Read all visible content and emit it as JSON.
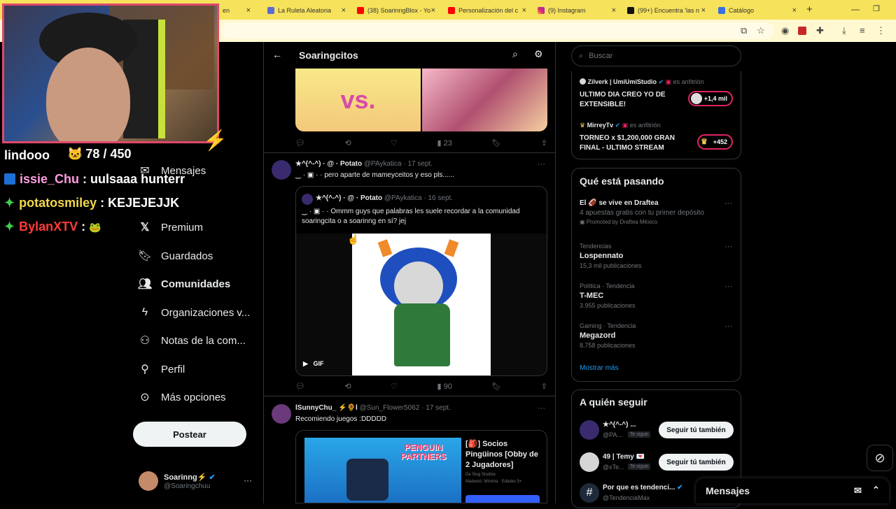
{
  "browser": {
    "tabs": [
      {
        "label": "en",
        "left": 0
      },
      {
        "label": "La Ruleta Aleatoria"
      },
      {
        "label": "(38) SoarinngBlox - Yo"
      },
      {
        "label": "Personalización del c"
      },
      {
        "label": "(9) Instagram"
      },
      {
        "label": "(99+) Encuentra 'las n"
      },
      {
        "label": "Catálogo"
      }
    ],
    "new_tab": "+",
    "close": "×"
  },
  "chat": {
    "counter_label": "lindooo",
    "viewer_count": "78 / 450",
    "lines": [
      {
        "user": "issie_Chu",
        "sep": " : ",
        "msg": "uulsaaa hunterr",
        "color": "#ff9de0"
      },
      {
        "user": "potatosmiley",
        "sep": " : ",
        "msg": "KEJEJEJJK",
        "color": "#f2d84b"
      },
      {
        "user": "BylanXTV",
        "sep": " : ",
        "msg": "",
        "color": "#ff3b3b"
      }
    ]
  },
  "nav": {
    "items": [
      {
        "label": "Mensajes",
        "icon": "mail-icon"
      },
      {
        "label": "Premium",
        "icon": "x-logo-icon"
      },
      {
        "label": "Guardados",
        "icon": "bookmark-icon"
      },
      {
        "label": "Comunidades",
        "icon": "community-icon"
      },
      {
        "label": "Organizaciones v...",
        "icon": "lightning-icon"
      },
      {
        "label": "Notas de la com...",
        "icon": "notes-icon"
      },
      {
        "label": "Perfil",
        "icon": "person-icon"
      },
      {
        "label": "Más opciones",
        "icon": "more-icon"
      }
    ],
    "post_button": "Postear",
    "account": {
      "name": "Soarinng⚡",
      "handle": "@Soaringchuu",
      "more": "···"
    }
  },
  "community": {
    "title": "Soaringcitos",
    "back": "←"
  },
  "tweets": [
    {
      "stats": {
        "views": "23"
      }
    },
    {
      "author": "★^(^-^)  · @ · Potato",
      "handle": "@PAykatica",
      "date": "· 17 sept.",
      "text": "‿ · ▣ ·  ·  pero aparte de mameyceitos y eso pls......",
      "quote": {
        "author": "★^(^-^)  · @ · Potato",
        "handle": "@PAykatica",
        "date": "· 16 sept.",
        "text": "‿ · ▣ ·  ·  Ommm guys que palabras les suele recordar a la comunidad soaringcita o a soarinng en sí? jej",
        "media_badge": "GIF"
      },
      "stats": {
        "views": "90"
      }
    },
    {
      "author": "lSunnyChu_ ⚡🌻l",
      "handle": "@Sun_Flower5062",
      "date": "· 17 sept.",
      "text": "Recomiendo juegos :DDDDD",
      "card": {
        "title": "[🎒] Socios Pingüinos [Obby de 2 Jugadores]",
        "meta": "De Slug Studios",
        "sub": "Madurez: Mínima · Edades 5+",
        "banner": "PENGUIN PARTNERS"
      }
    }
  ],
  "search": {
    "placeholder": "Buscar"
  },
  "spaces": [
    {
      "host": "Zilverk | UmiUmiStudio",
      "role": "es anfitrión",
      "title": "ULTIMO DIA CREO YO DE EXTENSIBLE!",
      "count": "+1,4 mil"
    },
    {
      "host": "MirreyTv",
      "role": "es anfitrión",
      "title": "TORNEO x $1,200,000 GRAN FINAL - ULTIMO STREAM",
      "count": "+452"
    }
  ],
  "trends": {
    "title": "Qué está pasando",
    "promo": {
      "name": "El 🏈 se vive en Draftea",
      "sub": "4 apuestas gratis con tu primer depósito",
      "by": "Promoted by Draftea México"
    },
    "items": [
      {
        "cat": "Tendencias",
        "name": "Lospennato",
        "count": "15,3 mil publicaciones"
      },
      {
        "cat": "Política · Tendencia",
        "name": "T-MEC",
        "count": "3.955 publicaciones"
      },
      {
        "cat": "Gaming · Tendencia",
        "name": "Megazord",
        "count": "8.758 publicaciones"
      }
    ],
    "more": "Mostrar más"
  },
  "who_to_follow": {
    "title": "A quién seguir",
    "items": [
      {
        "name": "★^(^-^) ...",
        "handle": "@PA...",
        "badge": "Te sigue",
        "button": "Seguir tú también"
      },
      {
        "name": "49 | Temy 💌",
        "handle": "@xTe...",
        "badge": "Te sigue",
        "button": "Seguir tú también"
      },
      {
        "name": "Por que es tendenci...",
        "handle": "@TendenciaMax",
        "badge": "",
        "button": ""
      }
    ]
  },
  "messages_bar": {
    "label": "Mensajes"
  },
  "colors": {
    "accent": "#1d9bf0",
    "verified": "#1d9bf0",
    "live": "#e0245e"
  }
}
